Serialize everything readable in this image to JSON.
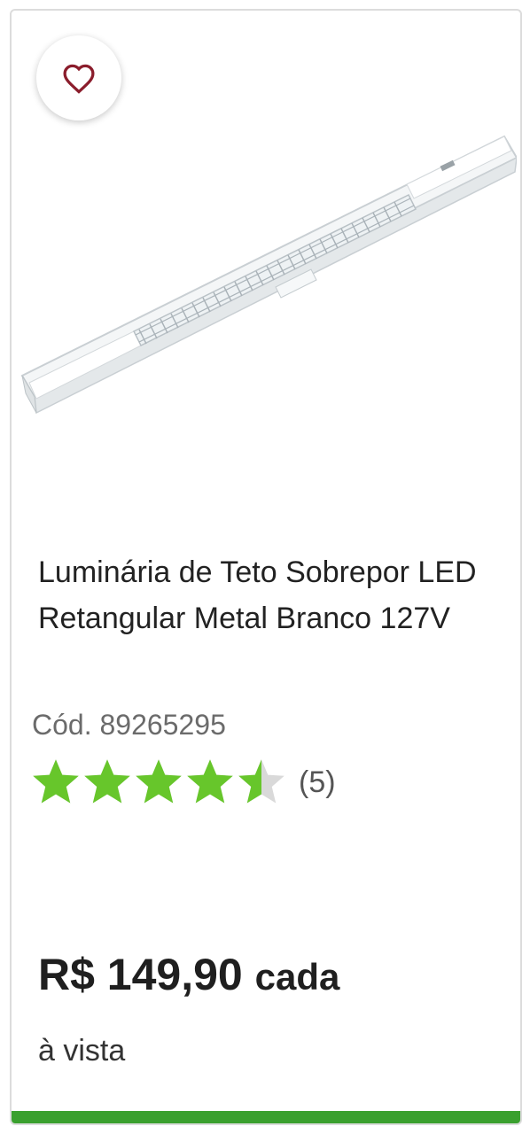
{
  "product": {
    "favorite_icon": "heart-outline-icon",
    "title": "Luminária de Teto Sobrepor LED Retangular Metal Branco 127V",
    "code": "Cód. 89265295",
    "rating": {
      "stars": 4.5,
      "max_stars": 5,
      "count": "(5)"
    },
    "price": {
      "amount": "R$ 149,90",
      "unit": "cada"
    },
    "payment_note": "à vista"
  },
  "colors": {
    "star_filled": "#67c62b",
    "star_empty": "#d9d9d9",
    "heart": "#8b1d2c",
    "accent_bar": "#3aa02e"
  }
}
